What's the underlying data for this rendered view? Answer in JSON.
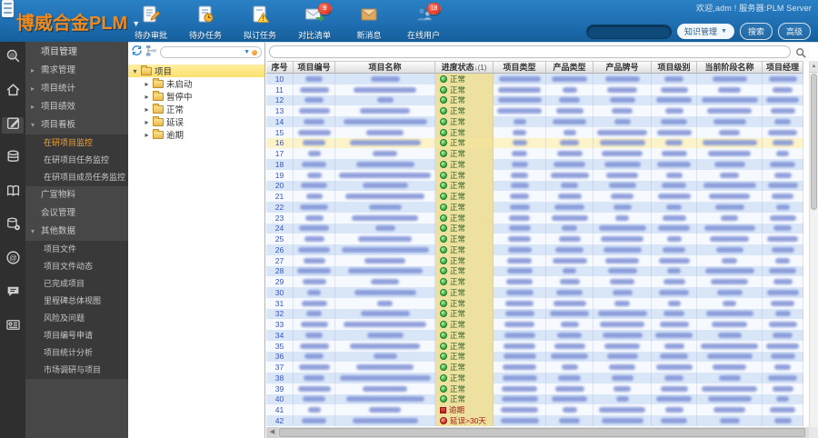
{
  "window": {
    "welcome": "欢迎,adm ! 服务器:PLM Server"
  },
  "header": {
    "logo": "博威合金PLM",
    "toolbar": [
      {
        "label": "待办审批",
        "icon": "doc-pencil-icon",
        "badge": ""
      },
      {
        "label": "待办任务",
        "icon": "doc-clock-icon",
        "badge": ""
      },
      {
        "label": "拟订任务",
        "icon": "doc-warning-icon",
        "badge": ""
      },
      {
        "label": "对比清单",
        "icon": "mail-compare-icon",
        "badge": "9"
      },
      {
        "label": "新消息",
        "icon": "mail-icon",
        "badge": ""
      },
      {
        "label": "在线用户",
        "icon": "online-users-icon",
        "badge": "18"
      }
    ],
    "search": {
      "value": "",
      "category": "知识管理",
      "search_label": "搜索",
      "advanced_label": "高级"
    }
  },
  "icon_rail": [
    "search-icon",
    "home-icon",
    "edit-icon",
    "database-icon",
    "book-icon",
    "database-settings-icon",
    "at-icon",
    "chat-icon",
    "idcard-icon"
  ],
  "sidebar": {
    "title": "项目管理",
    "items": [
      {
        "label": "需求管理",
        "arrow": "collapsed"
      },
      {
        "label": "项目统计",
        "arrow": "collapsed"
      },
      {
        "label": "项目绩效",
        "arrow": "collapsed"
      },
      {
        "label": "项目看板",
        "arrow": "expanded"
      },
      {
        "label": "在研项目监控",
        "sub": true,
        "active": true
      },
      {
        "label": "在研项目任务监控",
        "sub": true
      },
      {
        "label": "在研项目成员任务监控",
        "sub": true
      },
      {
        "label": "广宣物料"
      },
      {
        "label": "会议管理"
      },
      {
        "label": "其他数据",
        "arrow": "expanded"
      },
      {
        "label": "项目文件",
        "sub": true
      },
      {
        "label": "项目文件动态",
        "sub": true
      },
      {
        "label": "已完成项目",
        "sub": true
      },
      {
        "label": "里程碑总体视图",
        "sub": true
      },
      {
        "label": "风险及问题",
        "sub": true
      },
      {
        "label": "项目编号申请",
        "sub": true
      },
      {
        "label": "项目统计分析",
        "sub": true
      },
      {
        "label": "市场调研与项目",
        "sub": true
      }
    ]
  },
  "tree": {
    "root_label": "项目",
    "folders": [
      "未启动",
      "暂停中",
      "正常",
      "延误",
      "逾期"
    ]
  },
  "table": {
    "columns": [
      "序号",
      "项目编号",
      "项目名称",
      "进度状态",
      "项目类型",
      "产品类型",
      "产品牌号",
      "项目级别",
      "当前阶段名称",
      "项目经理"
    ],
    "sort_indicator": "↓(1)",
    "sort_column": 3,
    "rows": [
      {
        "seq": "10",
        "status": "正常",
        "status_icon": "green-ball-icon"
      },
      {
        "seq": "11",
        "status": "正常",
        "status_icon": "green-ball-icon"
      },
      {
        "seq": "12",
        "status": "正常",
        "status_icon": "green-ball-icon"
      },
      {
        "seq": "13",
        "status": "正常",
        "status_icon": "green-ball-icon"
      },
      {
        "seq": "14",
        "status": "正常",
        "status_icon": "green-ball-icon"
      },
      {
        "seq": "15",
        "status": "正常",
        "status_icon": "green-ball-icon"
      },
      {
        "seq": "16",
        "status": "正常",
        "status_icon": "green-ball-icon",
        "highlight": true
      },
      {
        "seq": "17",
        "status": "正常",
        "status_icon": "green-ball-icon"
      },
      {
        "seq": "18",
        "status": "正常",
        "status_icon": "green-ball-icon"
      },
      {
        "seq": "19",
        "status": "正常",
        "status_icon": "green-ball-icon"
      },
      {
        "seq": "20",
        "status": "正常",
        "status_icon": "green-ball-icon"
      },
      {
        "seq": "21",
        "status": "正常",
        "status_icon": "green-ball-icon"
      },
      {
        "seq": "22",
        "status": "正常",
        "status_icon": "green-ball-icon"
      },
      {
        "seq": "23",
        "status": "正常",
        "status_icon": "green-ball-icon"
      },
      {
        "seq": "24",
        "status": "正常",
        "status_icon": "green-ball-icon"
      },
      {
        "seq": "25",
        "status": "正常",
        "status_icon": "green-ball-icon"
      },
      {
        "seq": "26",
        "status": "正常",
        "status_icon": "green-ball-icon"
      },
      {
        "seq": "27",
        "status": "正常",
        "status_icon": "green-ball-icon"
      },
      {
        "seq": "28",
        "status": "正常",
        "status_icon": "green-ball-icon"
      },
      {
        "seq": "29",
        "status": "正常",
        "status_icon": "green-ball-icon"
      },
      {
        "seq": "30",
        "status": "正常",
        "status_icon": "green-ball-icon"
      },
      {
        "seq": "31",
        "status": "正常",
        "status_icon": "green-ball-icon"
      },
      {
        "seq": "32",
        "status": "正常",
        "status_icon": "green-ball-icon"
      },
      {
        "seq": "33",
        "status": "正常",
        "status_icon": "green-ball-icon"
      },
      {
        "seq": "34",
        "status": "正常",
        "status_icon": "green-ball-icon"
      },
      {
        "seq": "35",
        "status": "正常",
        "status_icon": "green-ball-icon"
      },
      {
        "seq": "36",
        "status": "正常",
        "status_icon": "green-ball-icon"
      },
      {
        "seq": "37",
        "status": "正常",
        "status_icon": "green-ball-icon"
      },
      {
        "seq": "38",
        "status": "正常",
        "status_icon": "green-ball-icon"
      },
      {
        "seq": "39",
        "status": "正常",
        "status_icon": "green-ball-icon"
      },
      {
        "seq": "40",
        "status": "正常",
        "status_icon": "green-ball-icon"
      },
      {
        "seq": "41",
        "status": "逾期",
        "status_icon": "red-square-icon"
      },
      {
        "seq": "42",
        "status": "延误>30天",
        "status_icon": "red-ball-icon"
      }
    ],
    "note_redacted_cells": "项目编号/项目名称/项目类型/产品类型/产品牌号/项目级别/当前阶段名称/项目经理 列内容在截图中为模糊处理"
  }
}
